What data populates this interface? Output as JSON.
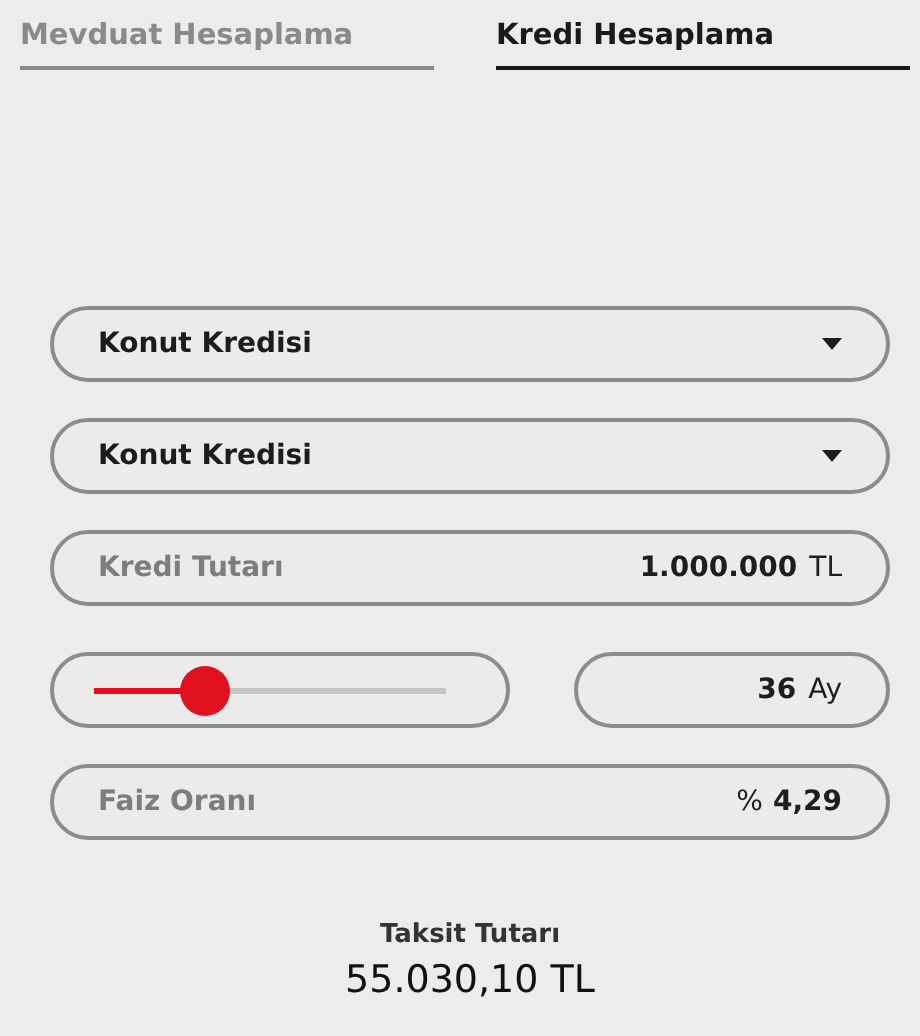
{
  "tabs": [
    {
      "label": "Mevduat Hesaplama",
      "selected": false
    },
    {
      "label": "Kredi Hesaplama",
      "selected": true
    }
  ],
  "dropdowns": [
    {
      "value": "Konut Kredisi"
    },
    {
      "value": "Konut Kredisi"
    }
  ],
  "loan_amount": {
    "label": "Kredi Tutarı",
    "value": "1.000.000",
    "unit": "TL"
  },
  "term": {
    "level": 0.31,
    "value": "36",
    "unit": "Ay"
  },
  "interest_rate": {
    "label": "Faiz Oranı",
    "prefix": "%",
    "value": "4,29"
  },
  "result": {
    "label": "Taksit Tutarı",
    "value": "55.030,10 TL"
  }
}
